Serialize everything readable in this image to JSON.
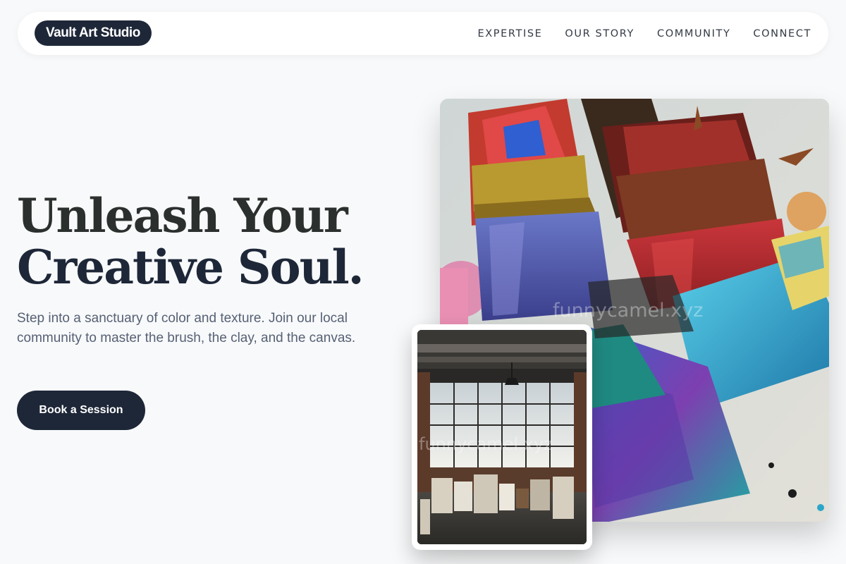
{
  "header": {
    "logo": "Vault Art Studio",
    "nav": [
      {
        "label": "EXPERTISE"
      },
      {
        "label": "OUR STORY"
      },
      {
        "label": "COMMUNITY"
      },
      {
        "label": "CONNECT"
      }
    ]
  },
  "hero": {
    "title_line1": "Unleash Your",
    "title_line2": "Creative Soul.",
    "subtitle": "Step into a sanctuary of color and texture. Join our local community to master the brush, the clay, and the canvas.",
    "cta_label": "Book a Session"
  },
  "images": {
    "main_watermark": "funnycamel.xyz",
    "small_watermark": "funnycamel.xyz"
  },
  "colors": {
    "brand_dark": "#1e2738",
    "background": "#f8f9fa",
    "text_muted": "#566175"
  }
}
